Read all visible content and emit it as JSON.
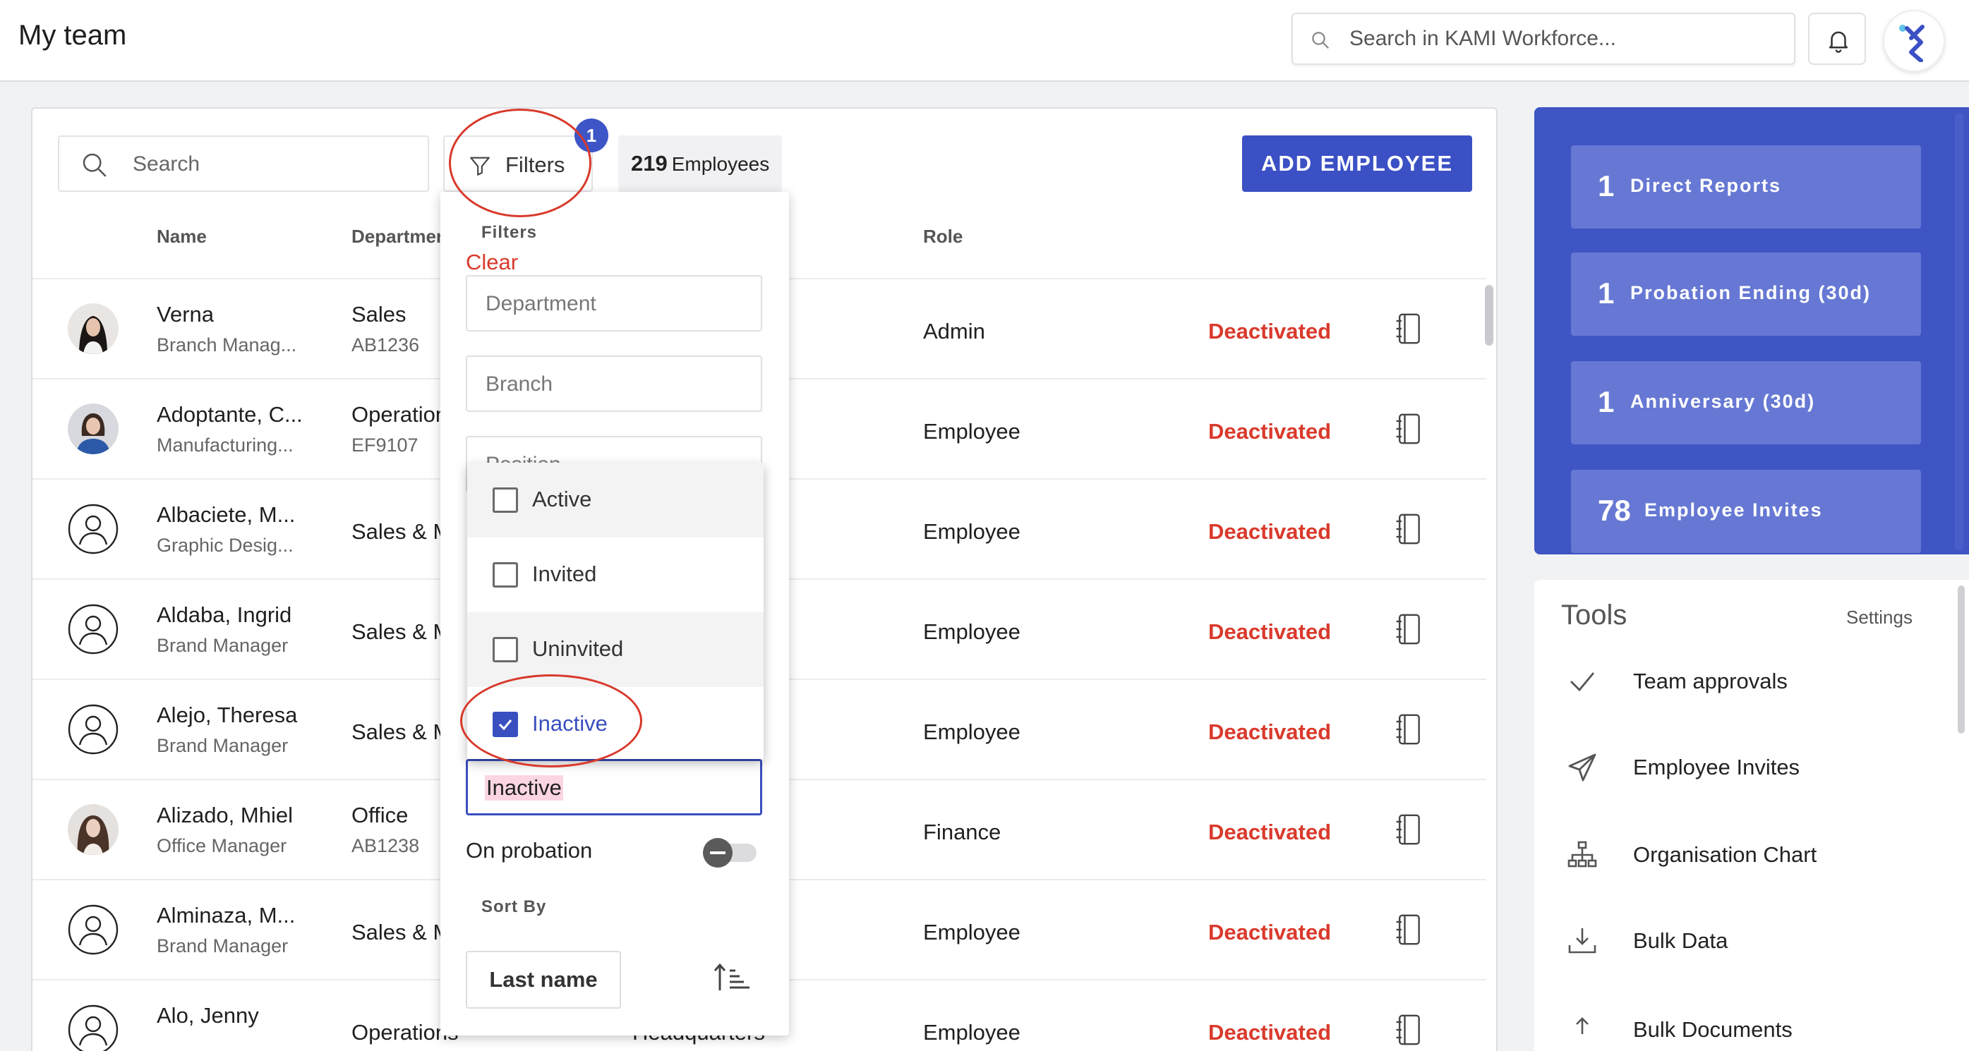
{
  "header": {
    "title": "My team",
    "search_placeholder": "Search in KAMI Workforce..."
  },
  "toolbar": {
    "search_placeholder": "Search",
    "filters_label": "Filters",
    "filter_count": "1",
    "employee_count": "219",
    "employee_word": "Employees",
    "add_button": "ADD EMPLOYEE"
  },
  "table": {
    "columns": {
      "name": "Name",
      "department": "Departmen",
      "role": "Role"
    },
    "rows": [
      {
        "name": "Verna",
        "title": "Branch Manag...",
        "department": "Sales",
        "code": "AB1236",
        "role": "Admin",
        "status": "Deactivated",
        "avatar": "photo"
      },
      {
        "name": "Adoptante, C...",
        "title": "Manufacturing...",
        "department": "Operation",
        "code": "EF9107",
        "role": "Employee",
        "status": "Deactivated",
        "avatar": "photo"
      },
      {
        "name": "Albaciete, M...",
        "title": "Graphic Desig...",
        "department": "Sales & M",
        "code": "",
        "role": "Employee",
        "status": "Deactivated",
        "avatar": "default"
      },
      {
        "name": "Aldaba, Ingrid",
        "title": "Brand Manager",
        "department": "Sales & M",
        "code": "",
        "role": "Employee",
        "status": "Deactivated",
        "avatar": "default"
      },
      {
        "name": "Alejo, Theresa",
        "title": "Brand Manager",
        "department": "Sales & M",
        "code": "",
        "role": "Employee",
        "status": "Deactivated",
        "avatar": "default"
      },
      {
        "name": "Alizado, Mhiel",
        "title": "Office Manager",
        "department": "Office",
        "code": "AB1238",
        "role": "Finance",
        "status": "Deactivated",
        "avatar": "photo"
      },
      {
        "name": "Alminaza, M...",
        "title": "Brand Manager",
        "department": "Sales & M",
        "code": "",
        "role": "Employee",
        "status": "Deactivated",
        "avatar": "default"
      },
      {
        "name": "Alo, Jenny",
        "title": "",
        "department": "Operations",
        "code": "",
        "role": "Employee",
        "status": "Deactivated",
        "avatar": "default",
        "branch_partial": "Headquarters"
      }
    ]
  },
  "filter_panel": {
    "title": "Filters",
    "clear_label": "Clear",
    "department_placeholder": "Department",
    "branch_placeholder": "Branch",
    "position_placeholder": "Position",
    "status_value": "Inactive",
    "status_options": [
      {
        "label": "Active",
        "checked": false
      },
      {
        "label": "Invited",
        "checked": false
      },
      {
        "label": "Uninvited",
        "checked": false
      },
      {
        "label": "Inactive",
        "checked": true
      }
    ],
    "probation_label": "On probation",
    "probation_on": false,
    "sort_title": "Sort By",
    "sort_value": "Last name"
  },
  "stats": [
    {
      "count": "1",
      "label": "Direct Reports"
    },
    {
      "count": "1",
      "label": "Probation Ending (30d)"
    },
    {
      "count": "1",
      "label": "Anniversary (30d)"
    },
    {
      "count": "78",
      "label": "Employee Invites"
    }
  ],
  "tools": {
    "title": "Tools",
    "settings_label": "Settings",
    "items": [
      {
        "label": "Team approvals",
        "icon": "check-icon"
      },
      {
        "label": "Employee Invites",
        "icon": "send-icon"
      },
      {
        "label": "Organisation Chart",
        "icon": "org-chart-icon"
      },
      {
        "label": "Bulk Data",
        "icon": "download-tray-icon"
      },
      {
        "label": "Bulk Documents",
        "icon": "upload-icon"
      }
    ]
  },
  "colors": {
    "primary": "#3b50c4",
    "danger": "#d93a2c",
    "stats_bg": "#3f55c4",
    "stat_card": "#6678d3",
    "annotation": "#d8392b"
  }
}
